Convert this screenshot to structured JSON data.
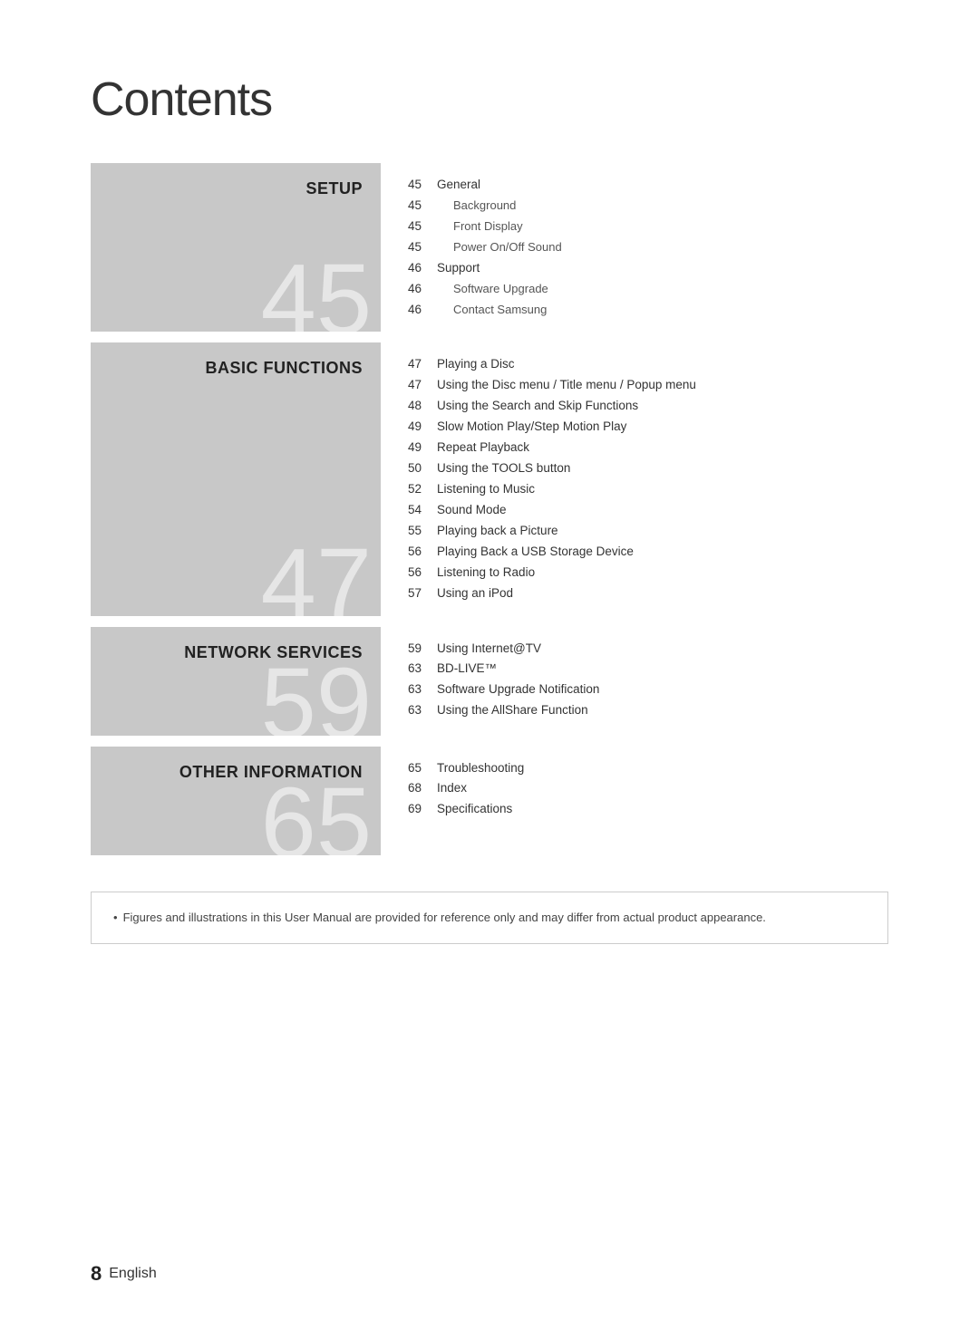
{
  "page": {
    "title": "Contents",
    "footer": {
      "page_number": "8",
      "language": "English"
    }
  },
  "sections": [
    {
      "id": "setup",
      "label": "SETUP",
      "number": "45",
      "items": [
        {
          "page": "45",
          "text": "General",
          "indent": false
        },
        {
          "page": "45",
          "text": "Background",
          "indent": true
        },
        {
          "page": "45",
          "text": "Front Display",
          "indent": true
        },
        {
          "page": "45",
          "text": "Power On/Off Sound",
          "indent": true
        },
        {
          "page": "46",
          "text": "Support",
          "indent": false
        },
        {
          "page": "46",
          "text": "Software Upgrade",
          "indent": true
        },
        {
          "page": "46",
          "text": "Contact Samsung",
          "indent": true
        }
      ]
    },
    {
      "id": "basic-functions",
      "label": "BASIC FUNCTIONS",
      "number": "47",
      "items": [
        {
          "page": "47",
          "text": "Playing a Disc",
          "indent": false
        },
        {
          "page": "47",
          "text": "Using the Disc menu / Title menu / Popup menu",
          "indent": false
        },
        {
          "page": "48",
          "text": "Using the Search and Skip Functions",
          "indent": false
        },
        {
          "page": "49",
          "text": "Slow Motion Play/Step Motion Play",
          "indent": false
        },
        {
          "page": "49",
          "text": "Repeat Playback",
          "indent": false
        },
        {
          "page": "50",
          "text": "Using the TOOLS button",
          "indent": false
        },
        {
          "page": "52",
          "text": "Listening to Music",
          "indent": false
        },
        {
          "page": "54",
          "text": "Sound Mode",
          "indent": false
        },
        {
          "page": "55",
          "text": "Playing back a Picture",
          "indent": false
        },
        {
          "page": "56",
          "text": "Playing Back a USB Storage Device",
          "indent": false
        },
        {
          "page": "56",
          "text": "Listening to Radio",
          "indent": false
        },
        {
          "page": "57",
          "text": "Using an iPod",
          "indent": false
        }
      ]
    },
    {
      "id": "network-services",
      "label": "NETWORK SERVICES",
      "number": "59",
      "items": [
        {
          "page": "59",
          "text": "Using Internet@TV",
          "indent": false
        },
        {
          "page": "63",
          "text": "BD-LIVE™",
          "indent": false
        },
        {
          "page": "63",
          "text": "Software Upgrade Notification",
          "indent": false
        },
        {
          "page": "63",
          "text": "Using the AllShare Function",
          "indent": false
        }
      ]
    },
    {
      "id": "other-information",
      "label": "OTHER INFORMATION",
      "number": "65",
      "items": [
        {
          "page": "65",
          "text": "Troubleshooting",
          "indent": false
        },
        {
          "page": "68",
          "text": "Index",
          "indent": false
        },
        {
          "page": "69",
          "text": "Specifications",
          "indent": false
        }
      ]
    }
  ],
  "note": {
    "bullet": "•",
    "text": "Figures and illustrations in this User Manual are provided for reference only and may differ from actual product appearance."
  }
}
